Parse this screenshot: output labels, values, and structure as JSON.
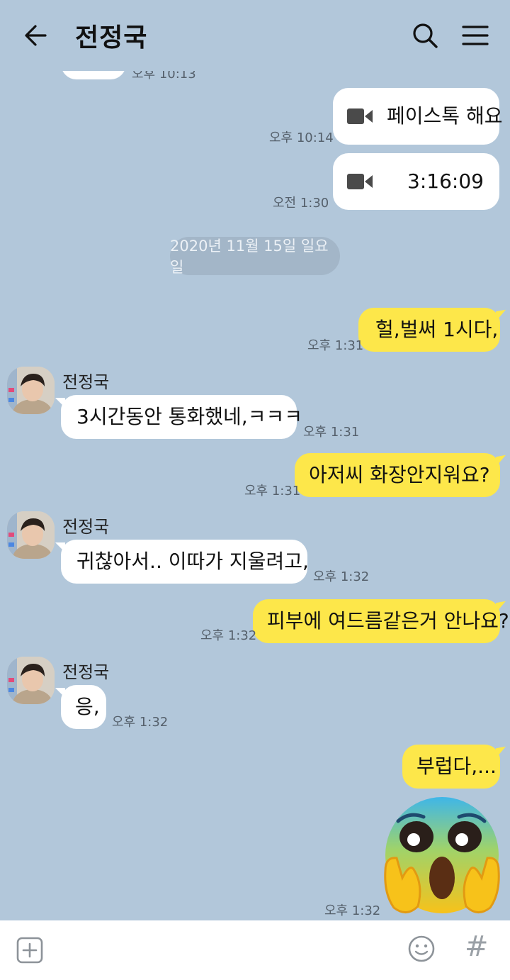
{
  "header": {
    "title": "전정국",
    "back_icon": "arrow-left-icon",
    "search_icon": "search-icon",
    "menu_icon": "hamburger-menu-icon"
  },
  "messages": {
    "partial_time": "오후 10:13",
    "facetime": {
      "text": "페이스톡 해요",
      "time": "오후 10:14"
    },
    "call_duration": {
      "text": "3:16:09",
      "time": "오전 1:30"
    },
    "date_divider": "2020년 11월 15일 일요일",
    "m1": {
      "text": "헐,벌써 1시다,",
      "time": "오후 1:31"
    },
    "m2": {
      "sender": "전정국",
      "text": "3시간동안 통화했네,ㅋㅋㅋ",
      "time": "오후 1:31"
    },
    "m3": {
      "text": "아저씨 화장안지워요?",
      "time": "오후 1:31"
    },
    "m4": {
      "sender": "전정국",
      "text": "귀찮아서.. 이따가 지울려고,",
      "time": "오후 1:32"
    },
    "m5": {
      "text": "피부에 여드름같은거 안나요?",
      "time": "오후 1:32"
    },
    "m6": {
      "sender": "전정국",
      "text": "응,",
      "time": "오후 1:32"
    },
    "m7": {
      "text": "부럽다,...",
      "time": ""
    },
    "m8": {
      "emoji": "fearful-screaming-face-emoji",
      "time": "오후 1:32"
    }
  },
  "input_bar": {
    "plus_icon": "plus-square-icon",
    "emoji_icon": "smiley-icon",
    "hash_label": "#"
  },
  "colors": {
    "background": "#b2c7da",
    "my_bubble": "#fde74a",
    "their_bubble": "#ffffff",
    "date_pill": "#a3b6c8"
  }
}
